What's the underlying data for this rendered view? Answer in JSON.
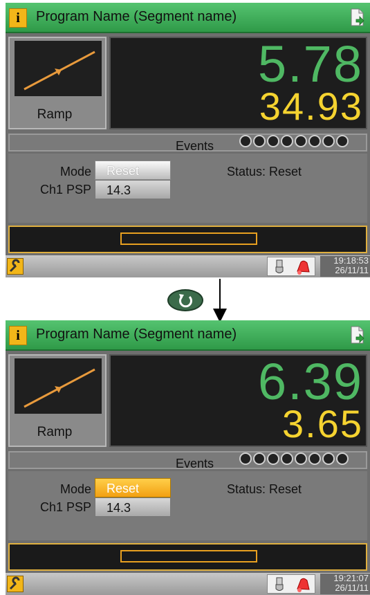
{
  "top_screen": {
    "title": "Program Name (Segment name)",
    "segment_type": "Ramp",
    "pv": "5.78",
    "sp": "34.93",
    "events_label": "Events",
    "event_count": 8,
    "mode_label": "Mode",
    "mode_value": "Reset",
    "psp_label": "Ch1 PSP",
    "psp_value": "14.3",
    "status": "Status: Reset",
    "time": "19:18:53",
    "date": "26/11/11"
  },
  "bottom_screen": {
    "title": "Program Name (Segment name)",
    "segment_type": "Ramp",
    "pv": "6.39",
    "sp": "3.65",
    "events_label": "Events",
    "event_count": 8,
    "mode_label": "Mode",
    "mode_value": "Reset",
    "psp_label": "Ch1 PSP",
    "psp_value": "14.3",
    "status": "Status: Reset",
    "time": "19:21:07",
    "date": "26/11/11"
  },
  "icons": {
    "info": "info-icon",
    "document": "document-export-icon",
    "wrench": "wrench-icon",
    "usb": "usb-icon",
    "alarm": "alarm-bell-icon",
    "refresh": "refresh-icon"
  },
  "colors": {
    "pv": "#4fb863",
    "sp": "#f5d330",
    "title_bar": "#3fae58",
    "accent": "#f2a012"
  }
}
